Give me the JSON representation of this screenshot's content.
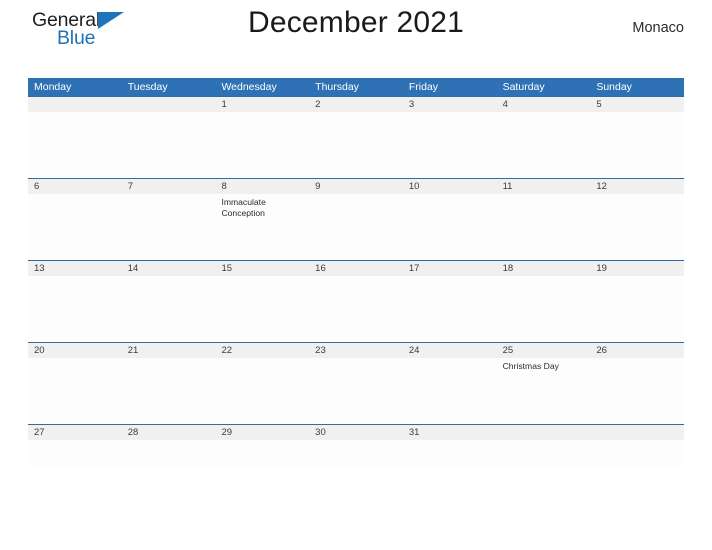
{
  "brand": {
    "name_part1": "General",
    "name_part2": "Blue",
    "triangle_color": "#1f74bd",
    "text_color": "#231f20",
    "blue_text_color": "#2272b8"
  },
  "header": {
    "title": "December 2021",
    "locale": "Monaco"
  },
  "calendar": {
    "header_color": "#2e72b5",
    "date_band_color": "#f0f0f0",
    "divider_color": "#2e6da4",
    "weekdays": [
      "Monday",
      "Tuesday",
      "Wednesday",
      "Thursday",
      "Friday",
      "Saturday",
      "Sunday"
    ],
    "weeks": [
      {
        "days": [
          {
            "num": "",
            "event": ""
          },
          {
            "num": "",
            "event": ""
          },
          {
            "num": "1",
            "event": ""
          },
          {
            "num": "2",
            "event": ""
          },
          {
            "num": "3",
            "event": ""
          },
          {
            "num": "4",
            "event": ""
          },
          {
            "num": "5",
            "event": ""
          }
        ]
      },
      {
        "days": [
          {
            "num": "6",
            "event": ""
          },
          {
            "num": "7",
            "event": ""
          },
          {
            "num": "8",
            "event": "Immaculate Conception"
          },
          {
            "num": "9",
            "event": ""
          },
          {
            "num": "10",
            "event": ""
          },
          {
            "num": "11",
            "event": ""
          },
          {
            "num": "12",
            "event": ""
          }
        ]
      },
      {
        "days": [
          {
            "num": "13",
            "event": ""
          },
          {
            "num": "14",
            "event": ""
          },
          {
            "num": "15",
            "event": ""
          },
          {
            "num": "16",
            "event": ""
          },
          {
            "num": "17",
            "event": ""
          },
          {
            "num": "18",
            "event": ""
          },
          {
            "num": "19",
            "event": ""
          }
        ]
      },
      {
        "days": [
          {
            "num": "20",
            "event": ""
          },
          {
            "num": "21",
            "event": ""
          },
          {
            "num": "22",
            "event": ""
          },
          {
            "num": "23",
            "event": ""
          },
          {
            "num": "24",
            "event": ""
          },
          {
            "num": "25",
            "event": "Christmas Day"
          },
          {
            "num": "26",
            "event": ""
          }
        ]
      },
      {
        "days": [
          {
            "num": "27",
            "event": ""
          },
          {
            "num": "28",
            "event": ""
          },
          {
            "num": "29",
            "event": ""
          },
          {
            "num": "30",
            "event": ""
          },
          {
            "num": "31",
            "event": ""
          },
          {
            "num": "",
            "event": ""
          },
          {
            "num": "",
            "event": ""
          }
        ]
      }
    ]
  }
}
